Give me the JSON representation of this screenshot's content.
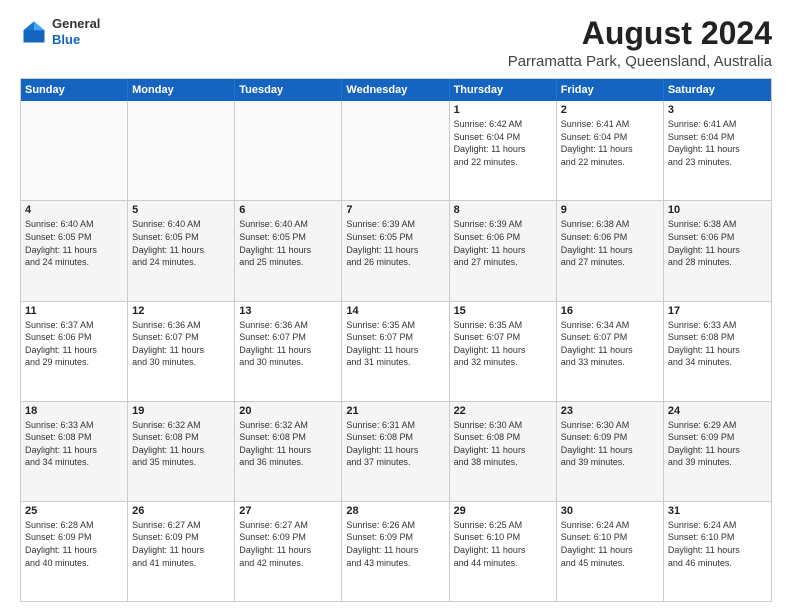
{
  "header": {
    "logo": {
      "general": "General",
      "blue": "Blue"
    },
    "title": "August 2024",
    "location": "Parramatta Park, Queensland, Australia"
  },
  "weekdays": [
    "Sunday",
    "Monday",
    "Tuesday",
    "Wednesday",
    "Thursday",
    "Friday",
    "Saturday"
  ],
  "rows": [
    [
      {
        "day": "",
        "info": ""
      },
      {
        "day": "",
        "info": ""
      },
      {
        "day": "",
        "info": ""
      },
      {
        "day": "",
        "info": ""
      },
      {
        "day": "1",
        "info": "Sunrise: 6:42 AM\nSunset: 6:04 PM\nDaylight: 11 hours\nand 22 minutes."
      },
      {
        "day": "2",
        "info": "Sunrise: 6:41 AM\nSunset: 6:04 PM\nDaylight: 11 hours\nand 22 minutes."
      },
      {
        "day": "3",
        "info": "Sunrise: 6:41 AM\nSunset: 6:04 PM\nDaylight: 11 hours\nand 23 minutes."
      }
    ],
    [
      {
        "day": "4",
        "info": "Sunrise: 6:40 AM\nSunset: 6:05 PM\nDaylight: 11 hours\nand 24 minutes."
      },
      {
        "day": "5",
        "info": "Sunrise: 6:40 AM\nSunset: 6:05 PM\nDaylight: 11 hours\nand 24 minutes."
      },
      {
        "day": "6",
        "info": "Sunrise: 6:40 AM\nSunset: 6:05 PM\nDaylight: 11 hours\nand 25 minutes."
      },
      {
        "day": "7",
        "info": "Sunrise: 6:39 AM\nSunset: 6:05 PM\nDaylight: 11 hours\nand 26 minutes."
      },
      {
        "day": "8",
        "info": "Sunrise: 6:39 AM\nSunset: 6:06 PM\nDaylight: 11 hours\nand 27 minutes."
      },
      {
        "day": "9",
        "info": "Sunrise: 6:38 AM\nSunset: 6:06 PM\nDaylight: 11 hours\nand 27 minutes."
      },
      {
        "day": "10",
        "info": "Sunrise: 6:38 AM\nSunset: 6:06 PM\nDaylight: 11 hours\nand 28 minutes."
      }
    ],
    [
      {
        "day": "11",
        "info": "Sunrise: 6:37 AM\nSunset: 6:06 PM\nDaylight: 11 hours\nand 29 minutes."
      },
      {
        "day": "12",
        "info": "Sunrise: 6:36 AM\nSunset: 6:07 PM\nDaylight: 11 hours\nand 30 minutes."
      },
      {
        "day": "13",
        "info": "Sunrise: 6:36 AM\nSunset: 6:07 PM\nDaylight: 11 hours\nand 30 minutes."
      },
      {
        "day": "14",
        "info": "Sunrise: 6:35 AM\nSunset: 6:07 PM\nDaylight: 11 hours\nand 31 minutes."
      },
      {
        "day": "15",
        "info": "Sunrise: 6:35 AM\nSunset: 6:07 PM\nDaylight: 11 hours\nand 32 minutes."
      },
      {
        "day": "16",
        "info": "Sunrise: 6:34 AM\nSunset: 6:07 PM\nDaylight: 11 hours\nand 33 minutes."
      },
      {
        "day": "17",
        "info": "Sunrise: 6:33 AM\nSunset: 6:08 PM\nDaylight: 11 hours\nand 34 minutes."
      }
    ],
    [
      {
        "day": "18",
        "info": "Sunrise: 6:33 AM\nSunset: 6:08 PM\nDaylight: 11 hours\nand 34 minutes."
      },
      {
        "day": "19",
        "info": "Sunrise: 6:32 AM\nSunset: 6:08 PM\nDaylight: 11 hours\nand 35 minutes."
      },
      {
        "day": "20",
        "info": "Sunrise: 6:32 AM\nSunset: 6:08 PM\nDaylight: 11 hours\nand 36 minutes."
      },
      {
        "day": "21",
        "info": "Sunrise: 6:31 AM\nSunset: 6:08 PM\nDaylight: 11 hours\nand 37 minutes."
      },
      {
        "day": "22",
        "info": "Sunrise: 6:30 AM\nSunset: 6:08 PM\nDaylight: 11 hours\nand 38 minutes."
      },
      {
        "day": "23",
        "info": "Sunrise: 6:30 AM\nSunset: 6:09 PM\nDaylight: 11 hours\nand 39 minutes."
      },
      {
        "day": "24",
        "info": "Sunrise: 6:29 AM\nSunset: 6:09 PM\nDaylight: 11 hours\nand 39 minutes."
      }
    ],
    [
      {
        "day": "25",
        "info": "Sunrise: 6:28 AM\nSunset: 6:09 PM\nDaylight: 11 hours\nand 40 minutes."
      },
      {
        "day": "26",
        "info": "Sunrise: 6:27 AM\nSunset: 6:09 PM\nDaylight: 11 hours\nand 41 minutes."
      },
      {
        "day": "27",
        "info": "Sunrise: 6:27 AM\nSunset: 6:09 PM\nDaylight: 11 hours\nand 42 minutes."
      },
      {
        "day": "28",
        "info": "Sunrise: 6:26 AM\nSunset: 6:09 PM\nDaylight: 11 hours\nand 43 minutes."
      },
      {
        "day": "29",
        "info": "Sunrise: 6:25 AM\nSunset: 6:10 PM\nDaylight: 11 hours\nand 44 minutes."
      },
      {
        "day": "30",
        "info": "Sunrise: 6:24 AM\nSunset: 6:10 PM\nDaylight: 11 hours\nand 45 minutes."
      },
      {
        "day": "31",
        "info": "Sunrise: 6:24 AM\nSunset: 6:10 PM\nDaylight: 11 hours\nand 46 minutes."
      }
    ]
  ]
}
